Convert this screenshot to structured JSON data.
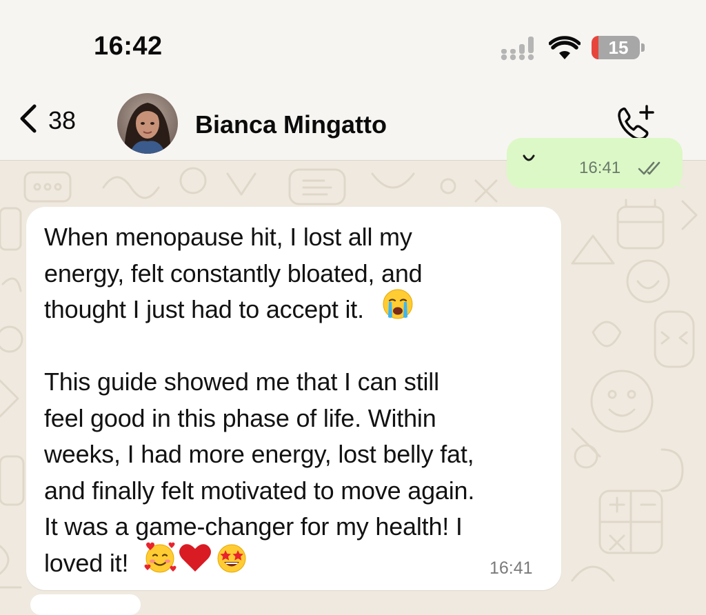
{
  "status_bar": {
    "time": "16:42",
    "battery_level": "15",
    "icons": [
      "signal-icon",
      "wifi-icon",
      "battery-icon"
    ]
  },
  "header": {
    "back_count": "38",
    "contact_name": "Bianca Mingatto",
    "icons": [
      "chevron-left-icon",
      "avatar",
      "add-call-icon"
    ]
  },
  "messages": {
    "outgoing": {
      "time": "16:41",
      "status": "read",
      "icon": "double-check-icon"
    },
    "incoming": {
      "lines": [
        "When menopause hit, I lost all my",
        "energy, felt constantly bloated, and",
        "thought I just had to accept it.  ",
        "",
        "This guide showed me that I can still",
        "feel good in this phase of life. Within",
        "weeks, I had more energy, lost belly fat,",
        "and finally felt motivated to move again.",
        "It was a game-changer for my health! I",
        "loved it! "
      ],
      "emojis": [
        "crying-face-emoji",
        "smiling-face-with-hearts-emoji",
        "red-heart-emoji",
        "star-struck-emoji"
      ],
      "time": "16:41"
    }
  },
  "colors": {
    "chat_background": "#efe9df",
    "header_background": "#f7f5f2",
    "outgoing_bubble": "#dcf8c6",
    "incoming_bubble": "#ffffff",
    "battery_low": "#e7453c"
  }
}
